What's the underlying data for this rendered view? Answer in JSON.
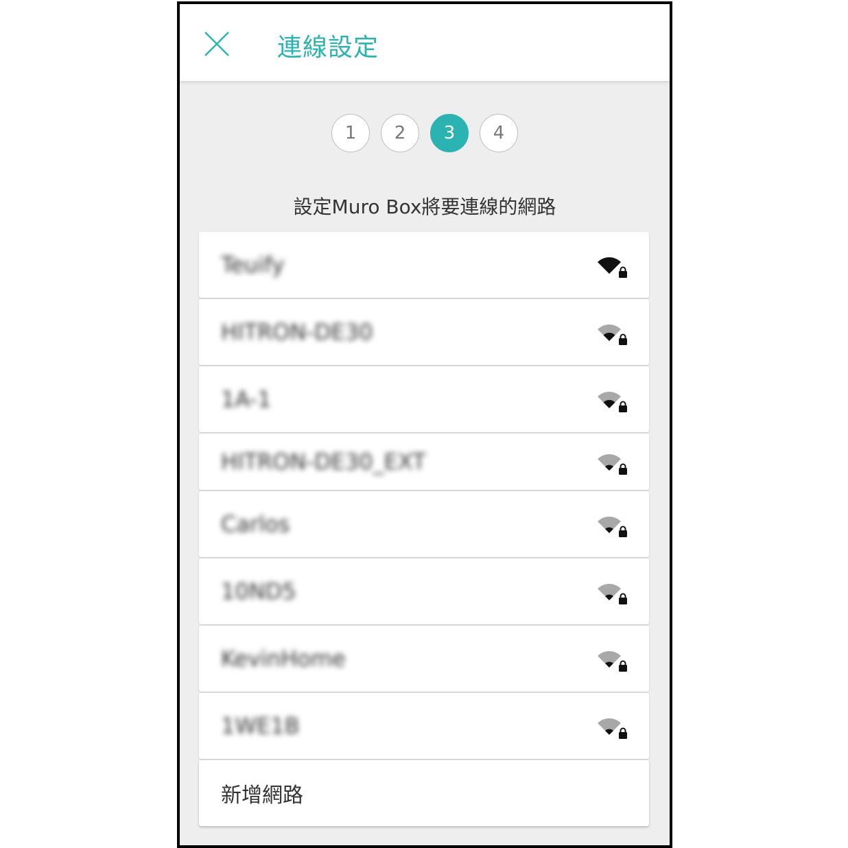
{
  "header": {
    "title": "連線設定",
    "close_icon": "close-icon"
  },
  "stepper": {
    "steps": [
      "1",
      "2",
      "3",
      "4"
    ],
    "active": "3"
  },
  "subtitle": "設定Muro Box將要連線的網路",
  "networks": [
    {
      "ssid": "Teuify",
      "icon": "wifi-lock-icon",
      "signal": 1.0
    },
    {
      "ssid": "HITRON-DE30",
      "icon": "wifi-lock-icon",
      "signal": 0.5
    },
    {
      "ssid": "1A-1",
      "icon": "wifi-lock-icon",
      "signal": 0.5
    },
    {
      "ssid": "HITRON-DE30_EXT",
      "icon": "wifi-lock-icon",
      "signal": 0.25
    },
    {
      "ssid": "Carlos",
      "icon": "wifi-lock-icon",
      "signal": 0.25
    },
    {
      "ssid": "10ND5",
      "icon": "wifi-lock-icon",
      "signal": 0.25
    },
    {
      "ssid": "KevinHome",
      "icon": "wifi-lock-icon",
      "signal": 0.25
    },
    {
      "ssid": "1WE1B",
      "icon": "wifi-lock-icon",
      "signal": 0.25
    }
  ],
  "add_network": "新增網路",
  "colors": {
    "accent": "#2bb3b1",
    "background": "#eeeeee",
    "card": "#ffffff"
  }
}
